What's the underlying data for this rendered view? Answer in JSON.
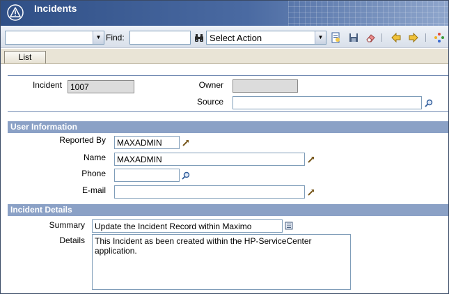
{
  "app": {
    "title": "Incidents"
  },
  "toolbar": {
    "query_select_value": "",
    "find_label": "Find:",
    "find_value": "",
    "action_select_value": "Select Action"
  },
  "tabs": [
    {
      "label": "List"
    }
  ],
  "header_fields": {
    "incident_label": "Incident",
    "incident_value": "1007",
    "owner_label": "Owner",
    "owner_value": "",
    "source_label": "Source",
    "source_value": ""
  },
  "user_information": {
    "section_title": "User Information",
    "reported_by_label": "Reported By",
    "reported_by_value": "MAXADMIN",
    "name_label": "Name",
    "name_value": "MAXADMIN",
    "phone_label": "Phone",
    "phone_value": "",
    "email_label": "E-mail",
    "email_value": ""
  },
  "incident_details": {
    "section_title": "Incident Details",
    "summary_label": "Summary",
    "summary_value": "Update the Incident Record within Maximo",
    "details_label": "Details",
    "details_value": "This Incident as been created within the HP-ServiceCenter\napplication."
  },
  "colors": {
    "title_bar": "#3a5a94",
    "section_header": "#8ba1c6",
    "tab_row": "#e9e4d6"
  }
}
